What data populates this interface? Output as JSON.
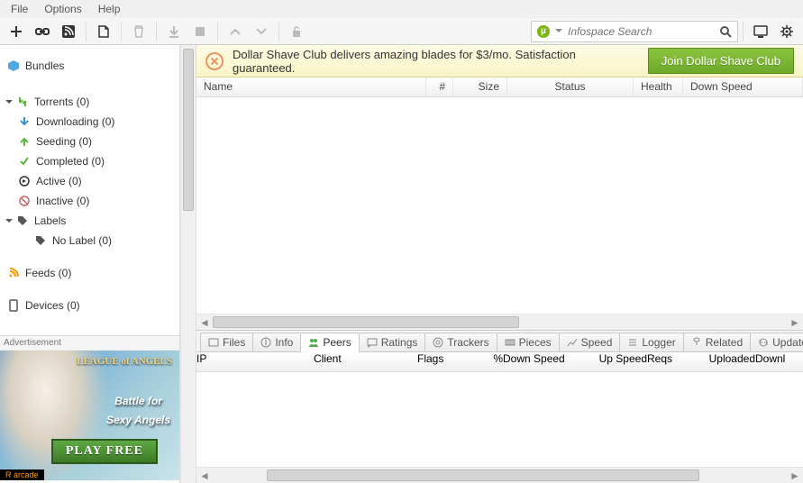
{
  "menu": {
    "file": "File",
    "options": "Options",
    "help": "Help"
  },
  "search": {
    "placeholder": "Infospace Search"
  },
  "sidebar": {
    "bundles": "Bundles",
    "torrents": "Torrents (0)",
    "downloading": "Downloading (0)",
    "seeding": "Seeding (0)",
    "completed": "Completed (0)",
    "active": "Active (0)",
    "inactive": "Inactive (0)",
    "labels": "Labels",
    "nolabel": "No Label (0)",
    "feeds": "Feeds (0)",
    "devices": "Devices (0)"
  },
  "banner": {
    "text": "Dollar Shave Club delivers amazing blades for $3/mo. Satisfaction guaranteed.",
    "button": "Join Dollar Shave Club"
  },
  "columns": {
    "name": "Name",
    "num": "#",
    "size": "Size",
    "status": "Status",
    "health": "Health",
    "downspeed": "Down Speed"
  },
  "tabs": {
    "files": "Files",
    "info": "Info",
    "peers": "Peers",
    "ratings": "Ratings",
    "trackers": "Trackers",
    "pieces": "Pieces",
    "speed": "Speed",
    "logger": "Logger",
    "related": "Related",
    "updates": "Updates"
  },
  "peer_columns": {
    "ip": "IP",
    "client": "Client",
    "flags": "Flags",
    "pct": "%",
    "downspeed": "Down Speed",
    "upspeed": "Up Speed",
    "reqs": "Reqs",
    "uploaded": "Uploaded",
    "downl": "Downl"
  },
  "ad": {
    "label": "Advertisement",
    "logo": "LEAGUE of ANGELS",
    "line1": "Battle for",
    "line2": "Sexy Angels",
    "play": "PLAY FREE",
    "badge": "R arcade"
  }
}
